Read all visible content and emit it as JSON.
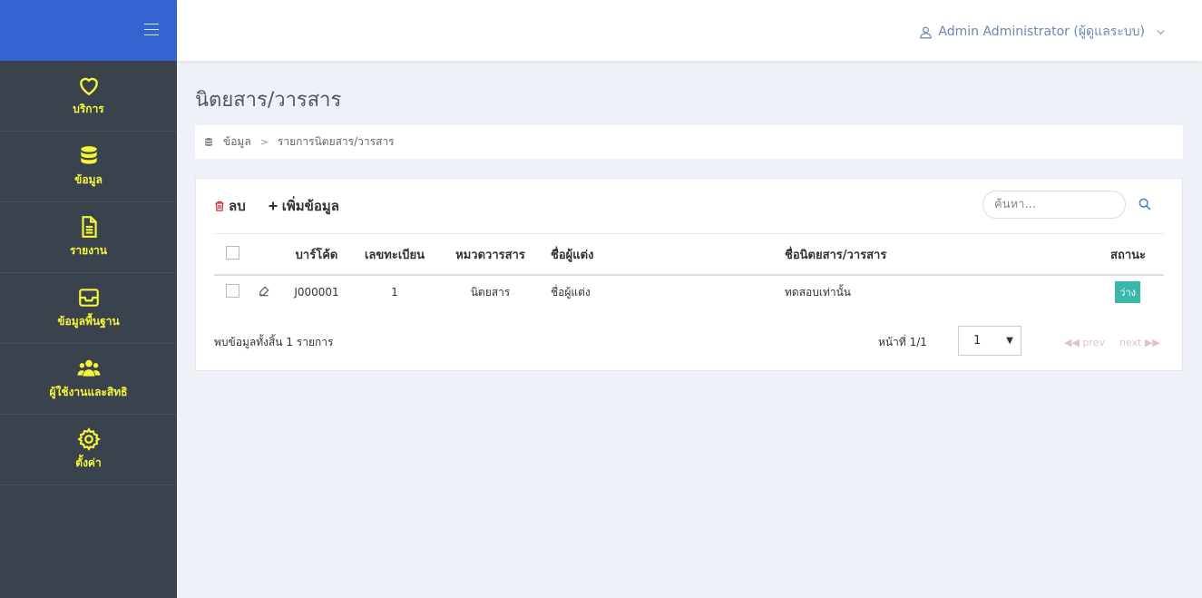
{
  "topbar": {
    "user_label": "Admin Administrator (ผู้ดูแลระบบ)"
  },
  "sidebar": {
    "items": [
      {
        "label": "บริการ",
        "icon": "heart-icon"
      },
      {
        "label": "ข้อมูล",
        "icon": "database-icon"
      },
      {
        "label": "รายงาน",
        "icon": "document-icon"
      },
      {
        "label": "ข้อมูลพื้นฐาน",
        "icon": "inbox-icon"
      },
      {
        "label": "ผู้ใช้งานและสิทธิ",
        "icon": "users-icon"
      },
      {
        "label": "ตั้งค่า",
        "icon": "gear-icon"
      }
    ]
  },
  "page": {
    "title": "นิตยสาร/วารสาร"
  },
  "breadcrumb": {
    "items": [
      "ข้อมูล",
      "รายการนิตยสาร/วารสาร"
    ]
  },
  "toolbar": {
    "delete_label": "ลบ",
    "add_label": "เพิ่มข้อมูล",
    "search_placeholder": "ค้นหา..."
  },
  "table": {
    "headers": [
      "บาร์โค้ด",
      "เลขทะเบียน",
      "หมวดวารสาร",
      "ชื่อผู้แต่ง",
      "ชื่อนิตยสาร/วารสาร",
      "สถานะ"
    ],
    "rows": [
      {
        "barcode": "J000001",
        "reg_no": "1",
        "category": "นิตยสาร",
        "author": "ชื่อผู้แต่ง",
        "title": "ทดสอบเท่านั้น",
        "status": "ว่าง"
      }
    ]
  },
  "pagination": {
    "total_text": "พบข้อมูลทั้งสิ้น 1 รายการ",
    "page_info": "หน้าที่ 1/1",
    "selected_page": "1",
    "prev_label": "◀◀ prev",
    "next_label": "next ▶▶"
  },
  "colors": {
    "brand": "#3464d1",
    "sidebar": "#3a434d",
    "sidebar_text": "#f5f53a",
    "status_badge": "#3bb8a9"
  }
}
